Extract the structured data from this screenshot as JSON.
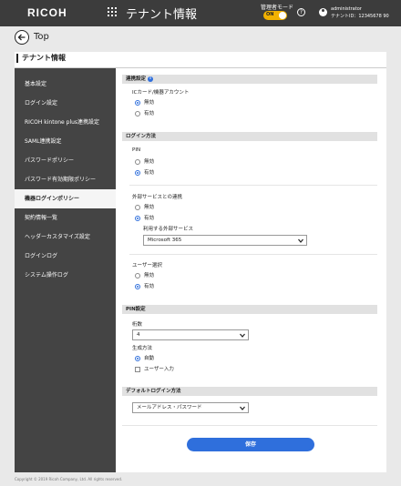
{
  "header": {
    "logo": "RICOH",
    "app_title": "テナント情報",
    "admin_mode_label": "管理者モード",
    "admin_toggle": "ON",
    "help_icon": "question-circle-icon",
    "user_icon": "user-circle-icon",
    "user_name": "administrator",
    "tenant_id": "テナントID：12345678 90"
  },
  "back": {
    "label": "Top",
    "icon": "arrow-left-circle-icon"
  },
  "panel_title": "テナント情報",
  "sidebar": {
    "items": [
      {
        "label": "基本設定"
      },
      {
        "label": "ログイン設定"
      },
      {
        "label": "RICOH kintone plus連携設定"
      },
      {
        "label": "SAML連携設定"
      },
      {
        "label": "パスワードポリシー"
      },
      {
        "label": "パスワード有効期限ポリシー"
      },
      {
        "label": "機器ログインポリシー"
      },
      {
        "label": "契約情報一覧"
      },
      {
        "label": "ヘッダーカスタマイズ設定"
      },
      {
        "label": "ログインログ"
      },
      {
        "label": "システム操作ログ"
      }
    ],
    "active_index": 6
  },
  "sections": {
    "link_settings": {
      "title": "連携設定",
      "info_icon": "info-icon",
      "ic_label": "ICカード/機器アカウント",
      "options": [
        "無効",
        "有効"
      ],
      "selected": "無効"
    },
    "login_method": {
      "title": "ログイン方法",
      "pin_label": "PIN",
      "pin_options": [
        "無効",
        "有効"
      ],
      "pin_selected": "有効",
      "external_label": "外部サービスとの連携",
      "external_options": [
        "無効",
        "有効"
      ],
      "external_selected": "有効",
      "service_label": "利用する外部サービス",
      "service_value": "Microsoft 365",
      "user_select_label": "ユーザー選択",
      "user_select_options": [
        "無効",
        "有効"
      ],
      "user_select_selected": "有効"
    },
    "pin_settings": {
      "title": "PIN設定",
      "digits_label": "桁数",
      "digits_value": "4",
      "generation_label": "生成方法",
      "generation_auto": "自動",
      "generation_user": "ユーザー入力",
      "generation_selected": "自動"
    },
    "default_login": {
      "title": "デフォルトログイン方法",
      "value": "メールアドレス・パスワード"
    }
  },
  "save_label": "保存",
  "copyright": "Copyright © 2019 Ricoh Company, Ltd. All rights reserved.",
  "colors": {
    "header_bg": "#3c3c3c",
    "sidebar_bg": "#444444",
    "accent": "#2f6fdc",
    "toggle": "#f2b100"
  }
}
